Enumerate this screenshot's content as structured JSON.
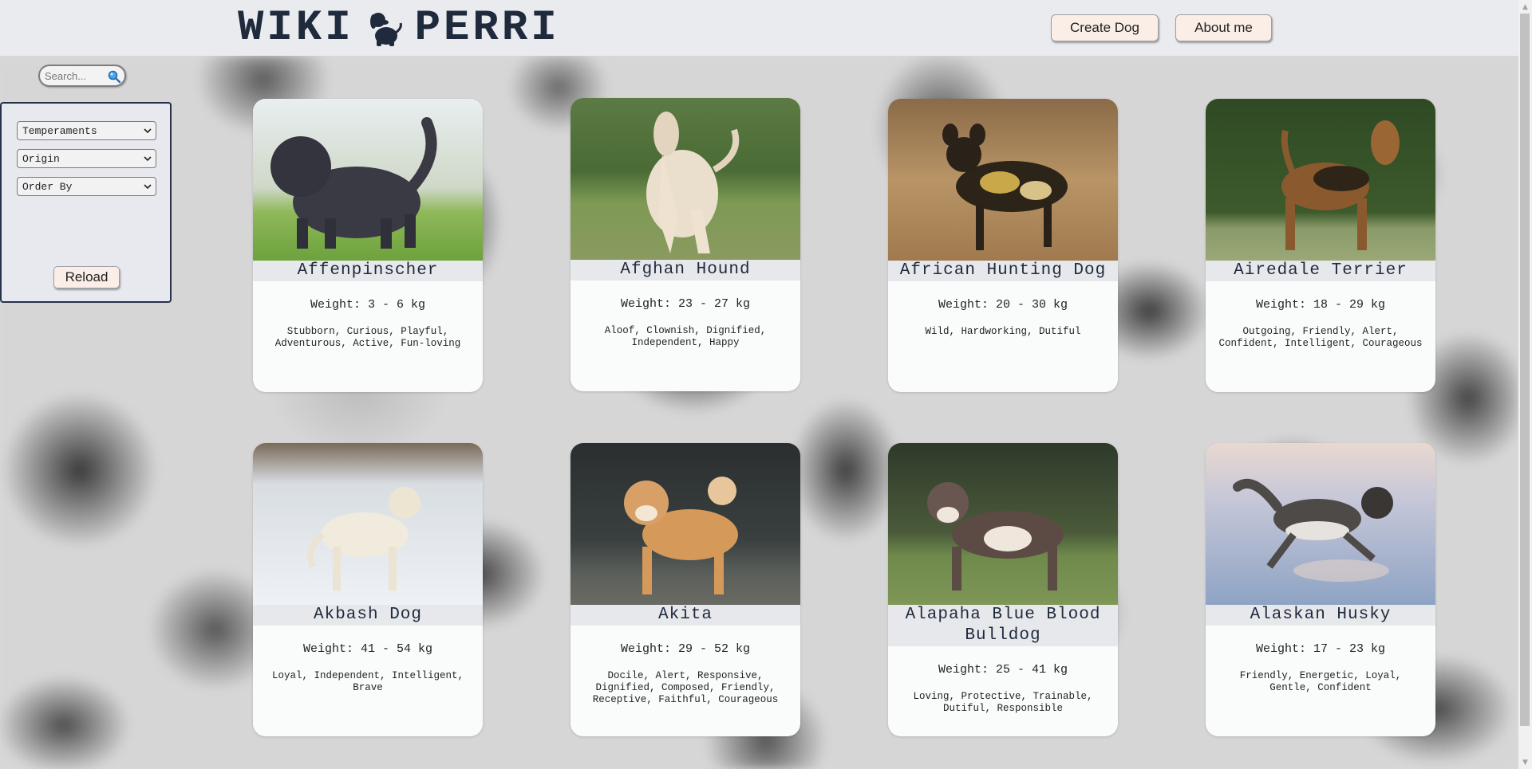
{
  "header": {
    "logo_left": "WIKI",
    "logo_right": "PERRI",
    "create_label": "Create Dog",
    "about_label": "About me"
  },
  "search": {
    "placeholder": "Search..."
  },
  "filters": {
    "temperaments": "Temperaments",
    "origin": "Origin",
    "order_by": "Order By",
    "reload_label": "Reload"
  },
  "cards": [
    {
      "name": "Affenpinscher",
      "weight": "Weight: 3 - 6 kg",
      "temperament": "Stubborn, Curious, Playful, Adventurous, Active, Fun-loving"
    },
    {
      "name": "Afghan Hound",
      "weight": "Weight: 23 - 27 kg",
      "temperament": "Aloof, Clownish, Dignified, Independent, Happy"
    },
    {
      "name": "African Hunting Dog",
      "weight": "Weight: 20 - 30 kg",
      "temperament": "Wild, Hardworking, Dutiful"
    },
    {
      "name": "Airedale Terrier",
      "weight": "Weight: 18 - 29 kg",
      "temperament": "Outgoing, Friendly, Alert, Confident, Intelligent, Courageous"
    },
    {
      "name": "Akbash Dog",
      "weight": "Weight: 41 - 54 kg",
      "temperament": "Loyal, Independent, Intelligent, Brave"
    },
    {
      "name": "Akita",
      "weight": "Weight: 29 - 52 kg",
      "temperament": "Docile, Alert, Responsive, Dignified, Composed, Friendly, Receptive, Faithful, Courageous"
    },
    {
      "name": "Alapaha Blue Blood Bulldog",
      "weight": "Weight: 25 - 41 kg",
      "temperament": "Loving, Protective, Trainable, Dutiful, Responsible"
    },
    {
      "name": "Alaskan Husky",
      "weight": "Weight: 17 - 23 kg",
      "temperament": "Friendly, Energetic, Loyal, Gentle, Confident"
    }
  ]
}
